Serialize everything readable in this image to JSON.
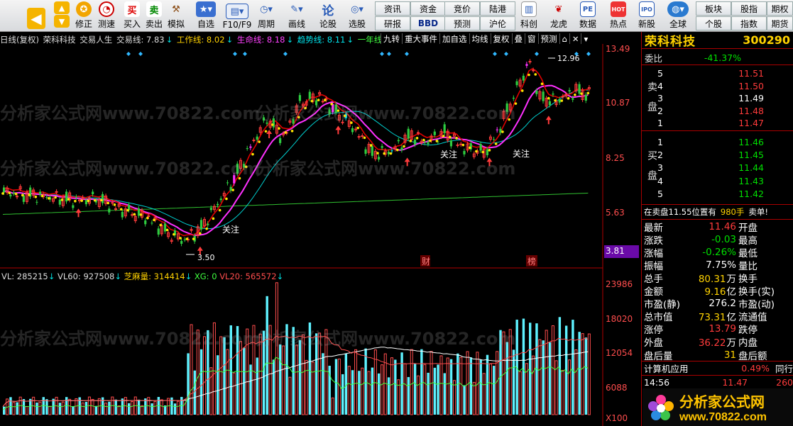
{
  "toolbar": {
    "items": [
      {
        "label": "",
        "icon": "back-arrow-icon"
      },
      {
        "label": "",
        "icon": "up-arrow-icon"
      },
      {
        "label": "修正",
        "icon": "medal-icon"
      },
      {
        "label": "测速",
        "icon": "clock-icon"
      },
      {
        "label": "买入",
        "icon": "buy-icon",
        "glyph": "买"
      },
      {
        "label": "卖出",
        "icon": "sell-icon",
        "glyph": "卖"
      },
      {
        "label": "模拟",
        "icon": "hammer-icon"
      },
      {
        "label": "自选",
        "icon": "star-icon"
      },
      {
        "label": "F10/F9",
        "icon": "f10-icon"
      },
      {
        "label": "周期",
        "icon": "cycle-icon"
      },
      {
        "label": "画线",
        "icon": "draw-icon"
      },
      {
        "label": "论股",
        "icon": "discuss-icon"
      },
      {
        "label": "选股",
        "icon": "select-stock-icon"
      },
      {
        "label": "科创",
        "icon": "kechuang-icon"
      },
      {
        "label": "龙虎",
        "icon": "longhu-icon"
      },
      {
        "label": "数据",
        "icon": "data-icon",
        "glyph": "PE"
      },
      {
        "label": "热点",
        "icon": "hot-icon",
        "glyph": "HOT"
      },
      {
        "label": "新股",
        "icon": "new-stock-icon",
        "glyph": "IPO"
      },
      {
        "label": "全球",
        "icon": "globe-icon"
      }
    ],
    "grid_buttons": [
      "资讯",
      "资金",
      "竞价",
      "陆港",
      "研报",
      "BBD",
      "预测",
      "沪伦"
    ],
    "right_buttons": [
      "板块",
      "股指",
      "期权",
      "个股",
      "指数",
      "期货"
    ]
  },
  "info": {
    "prefix": "日线(复权)",
    "stock": "荣科科技",
    "system": "交易人生",
    "jyx": "交易线: 7.83",
    "gzx": "工作线: 8.02",
    "smx": "生命线: 8.18",
    "qsx": "趋势线: 8.11",
    "ynx": "一年线"
  },
  "chart_buttons": [
    "九转",
    "重大事件",
    "加自选",
    "均线",
    "复权",
    "叠",
    "窗",
    "预测"
  ],
  "price_axis": [
    "13.49",
    "10.87",
    "8.25",
    "5.63",
    "3.81"
  ],
  "volume_axis": [
    "23986",
    "18020",
    "12054",
    "6088",
    "X100"
  ],
  "annotations": {
    "high": "12.96",
    "low": "3.50",
    "focus": "关注",
    "cai": "财",
    "bang": "榜"
  },
  "volume_line": {
    "vl": "VL: 285215",
    "vl60": "VL60: 927508",
    "zml": "芝麻量: 314414",
    "xg": "XG: 0",
    "vl20": "VL20: 565572"
  },
  "watermark": "分析家公式网www.70822.com",
  "panel": {
    "name": "荣科科技",
    "code": "300290",
    "wb_label": "委比",
    "wb_value": "-41.37%",
    "sell_label": "卖盘",
    "buy_label": "买盘",
    "sell": [
      {
        "lvl": "5",
        "price": "11.51"
      },
      {
        "lvl": "4",
        "price": "11.50"
      },
      {
        "lvl": "3",
        "price": "11.49"
      },
      {
        "lvl": "2",
        "price": "11.48"
      },
      {
        "lvl": "1",
        "price": "11.47"
      }
    ],
    "buy": [
      {
        "lvl": "1",
        "price": "11.46"
      },
      {
        "lvl": "2",
        "price": "11.45"
      },
      {
        "lvl": "3",
        "price": "11.44"
      },
      {
        "lvl": "4",
        "price": "11.43"
      },
      {
        "lvl": "5",
        "price": "11.42"
      }
    ],
    "notice": "在卖盘11.55位置有",
    "notice_qty": "980手",
    "notice_tag": "卖单!",
    "quotes": [
      {
        "l1": "最新",
        "v1": "11.46",
        "c1": "up",
        "l2": "开盘"
      },
      {
        "l1": "涨跌",
        "v1": "-0.03",
        "c1": "dn",
        "l2": "最高"
      },
      {
        "l1": "涨幅",
        "v1": "-0.26%",
        "c1": "dn",
        "l2": "最低"
      },
      {
        "l1": "振幅",
        "v1": "7.75%",
        "c1": "wt",
        "l2": "量比"
      },
      {
        "l1": "总手",
        "v1": "80.31",
        "u1": "万",
        "c1": "yl",
        "l2": "换手"
      },
      {
        "l1": "金额",
        "v1": "9.16",
        "u1": "亿",
        "c1": "yl",
        "l2": "换手(实)"
      },
      {
        "l1": "市盈(静)",
        "v1": "276.2",
        "c1": "wt",
        "l2": "市盈(动)"
      },
      {
        "l1": "总市值",
        "v1": "73.31",
        "u1": "亿",
        "c1": "yl",
        "l2": "流通值"
      },
      {
        "l1": "涨停",
        "v1": "13.79",
        "c1": "up",
        "l2": "跌停"
      },
      {
        "l1": "外盘",
        "v1": "36.22",
        "u1": "万",
        "c1": "up",
        "l2": "内盘"
      },
      {
        "l1": "盘后量",
        "v1": "31",
        "c1": "yl",
        "l2": "盘后额"
      }
    ],
    "sector": "计算机应用",
    "sector_pct": "0.49%",
    "sector_tag": "同行",
    "tick_time": "14:56",
    "tick_price": "11.47",
    "tick_vol": "260"
  },
  "logo": {
    "line1": "分析家公式网",
    "line2": "www.70822.com"
  }
}
